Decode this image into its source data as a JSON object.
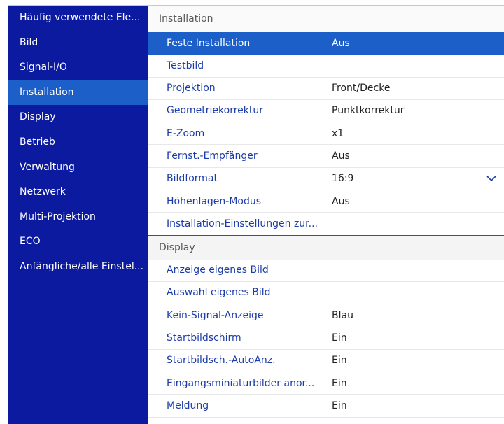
{
  "sidebar": {
    "items": [
      {
        "label": "Häufig verwendete Ele..."
      },
      {
        "label": "Bild"
      },
      {
        "label": "Signal-I/O"
      },
      {
        "label": "Installation"
      },
      {
        "label": "Display"
      },
      {
        "label": "Betrieb"
      },
      {
        "label": "Verwaltung"
      },
      {
        "label": "Netzwerk"
      },
      {
        "label": "Multi-Projektion"
      },
      {
        "label": "ECO"
      },
      {
        "label": "Anfängliche/alle Einstel..."
      }
    ],
    "active_index": 3
  },
  "installation": {
    "title": "Installation",
    "rows": [
      {
        "label": "Feste Installation",
        "value": "Aus"
      },
      {
        "label": "Testbild",
        "value": ""
      },
      {
        "label": "Projektion",
        "value": "Front/Decke"
      },
      {
        "label": "Geometriekorrektur",
        "value": "Punktkorrektur"
      },
      {
        "label": "E-Zoom",
        "value": "x1"
      },
      {
        "label": "Fernst.-Empfänger",
        "value": "Aus"
      },
      {
        "label": "Bildformat",
        "value": "16:9"
      },
      {
        "label": "Höhenlagen-Modus",
        "value": "Aus"
      },
      {
        "label": "Installation-Einstellungen zur...",
        "value": ""
      }
    ]
  },
  "display": {
    "title": "Display",
    "rows": [
      {
        "label": "Anzeige eigenes Bild",
        "value": ""
      },
      {
        "label": "Auswahl eigenes Bild",
        "value": ""
      },
      {
        "label": "Kein-Signal-Anzeige",
        "value": "Blau"
      },
      {
        "label": "Startbildschirm",
        "value": "Ein"
      },
      {
        "label": "Startbildsch.-AutoAnz.",
        "value": "Ein"
      },
      {
        "label": "Eingangsminiaturbilder anor...",
        "value": "Ein"
      },
      {
        "label": "Meldung",
        "value": "Ein"
      }
    ]
  },
  "colors": {
    "sidebar_bg": "#0b1a9e",
    "highlight": "#1d5fc9",
    "label_text": "#1b3ca8"
  },
  "icons": {
    "scroll_indicator": "chevron-down-icon"
  }
}
